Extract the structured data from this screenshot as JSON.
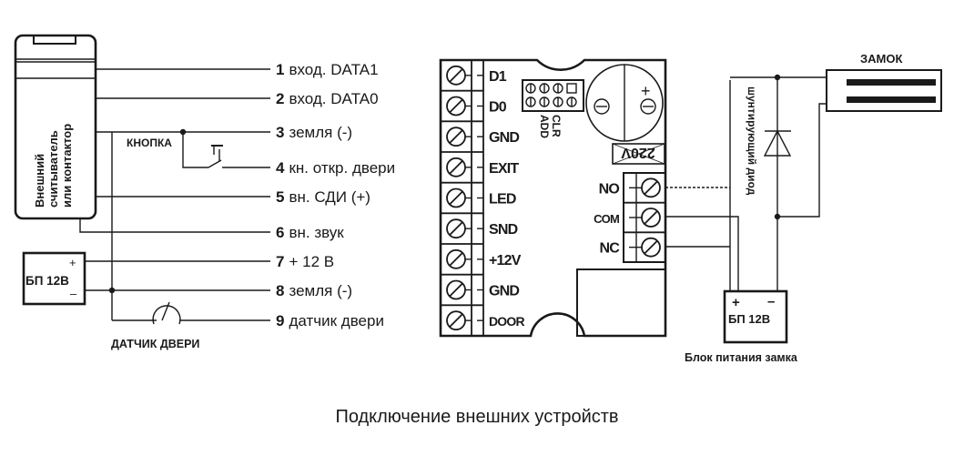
{
  "reader": {
    "label_lines": [
      "Внешний",
      "считыватель",
      "или контактор"
    ]
  },
  "button_label": "КНОПКА",
  "door_sensor_label": "ДАТЧИК ДВЕРИ",
  "psu_left": {
    "plus": "+",
    "minus": "–",
    "label": "БП 12В"
  },
  "pins": [
    {
      "num": "1",
      "text": "вход. DATA1"
    },
    {
      "num": "2",
      "text": "вход. DATA0"
    },
    {
      "num": "3",
      "text": "земля (-)"
    },
    {
      "num": "4",
      "text": "кн. откр. двери"
    },
    {
      "num": "5",
      "text": "вн. СДИ (+)"
    },
    {
      "num": "6",
      "text": "вн. звук"
    },
    {
      "num": "7",
      "text": "+ 12 В"
    },
    {
      "num": "8",
      "text": "земля (-)"
    },
    {
      "num": "9",
      "text": "датчик двери"
    }
  ],
  "controller": {
    "terminals": [
      "D1",
      "D0",
      "GND",
      "EXIT",
      "LED",
      "SND",
      "+12V",
      "GND",
      "DOOR"
    ],
    "jumper_labels": [
      "ADD",
      "CLR"
    ],
    "voltage_mark": "220V",
    "buzzer_plus": "+",
    "relay_terminals": [
      "NO",
      "COM",
      "NC"
    ]
  },
  "lock": {
    "label": "ЗАМОК",
    "diode_label": "шунтирующий диод"
  },
  "psu_lock": {
    "plus": "+",
    "minus": "–",
    "label": "БП 12В",
    "caption": "Блок питания замка"
  },
  "caption": "Подключение внешних устройств"
}
